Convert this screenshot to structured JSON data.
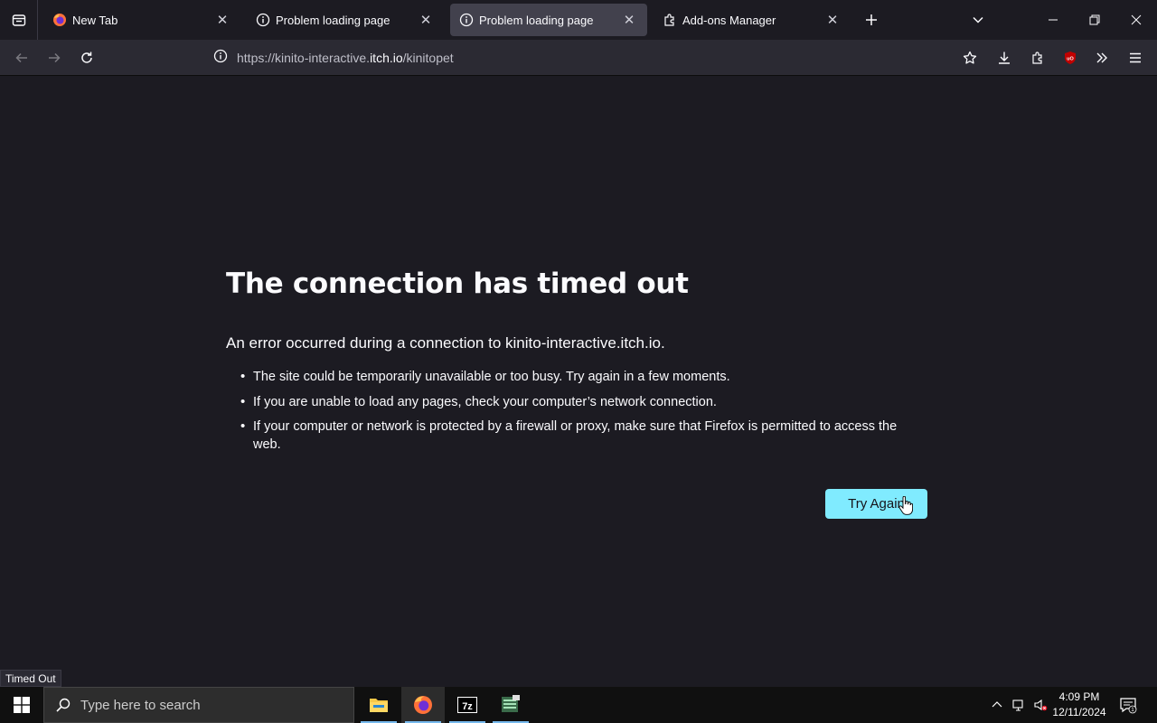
{
  "tabs": [
    {
      "label": "New Tab",
      "icon": "firefox-icon",
      "selected": false
    },
    {
      "label": "Problem loading page",
      "icon": "info-icon",
      "selected": false
    },
    {
      "label": "Problem loading page",
      "icon": "info-icon",
      "selected": true
    },
    {
      "label": "Add-ons Manager",
      "icon": "puzzle-icon",
      "selected": false
    }
  ],
  "url": {
    "prefix": "https://kinito-interactive.",
    "host": "itch.io",
    "path": "/kinitopet"
  },
  "error": {
    "title": "The connection has timed out",
    "intro": "An error occurred during a connection to kinito-interactive.itch.io.",
    "reasons": [
      "The site could be temporarily unavailable or too busy. Try again in a few moments.",
      "If you are unable to load any pages, check your computer’s network connection.",
      "If your computer or network is protected by a firewall or proxy, make sure that Firefox is permitted to access the web."
    ],
    "try_again_label": "Try Again"
  },
  "status_panel": "Timed Out",
  "taskbar": {
    "search_placeholder": "Type here to search",
    "time": "4:09 PM",
    "date": "12/11/2024",
    "notification_count": "1"
  },
  "colors": {
    "page_bg": "#1c1b22",
    "toolbar_bg": "#2b2a33",
    "selected_tab": "#42414d",
    "button_accent": "#80ebff",
    "taskbar_bg": "#101010"
  }
}
